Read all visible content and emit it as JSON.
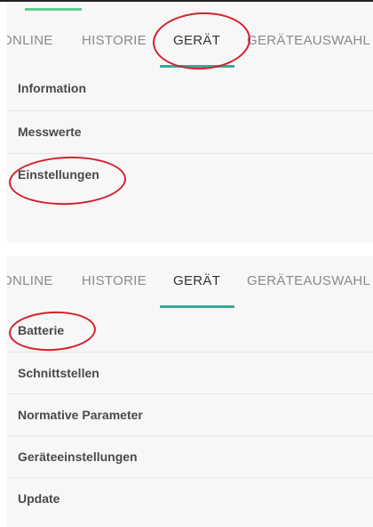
{
  "tabs": [
    "ONLINE",
    "HISTORIE",
    "GERÄT",
    "GERÄTEAUSWAHL"
  ],
  "active_tab": "GERÄT",
  "panel_top": {
    "items": [
      "Information",
      "Messwerte",
      "Einstellungen"
    ]
  },
  "panel_bottom": {
    "items": [
      "Batterie",
      "Schnittstellen",
      "Normative Parameter",
      "Geräteeinstellungen",
      "Update"
    ]
  },
  "colors": {
    "tab_indicator": "#3aa899",
    "highlight_circle": "#d4202a",
    "status_bar_accent": "#59d08c"
  }
}
